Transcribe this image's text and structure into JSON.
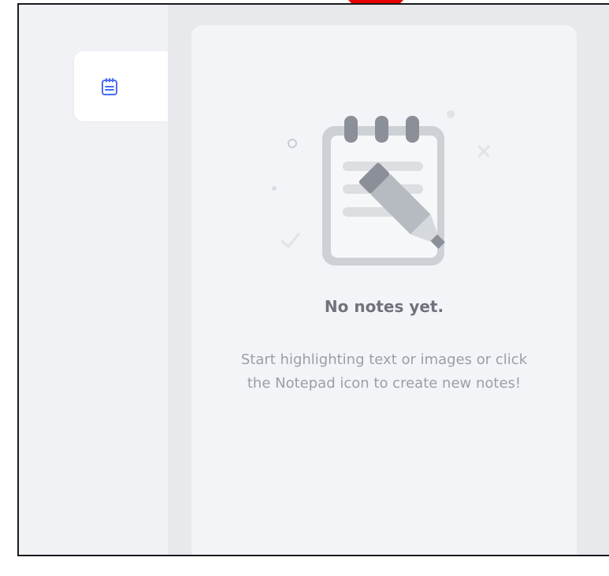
{
  "notes_panel": {
    "tab_icon": "notepad-icon",
    "empty_state": {
      "illustration": "notepad-with-pen-illustration",
      "title": "No notes yet.",
      "description": "Start highlighting text or images or click the Notepad icon to create new notes!"
    }
  },
  "colors": {
    "accent": "#4a6cf7",
    "panel_bg": "#f3f4f8",
    "rail_bg": "#f1f2f6",
    "outer_bg": "#e8e9ed",
    "pointer": "#e60000",
    "title_text": "#6f737b",
    "body_text": "#9a9ea7"
  }
}
